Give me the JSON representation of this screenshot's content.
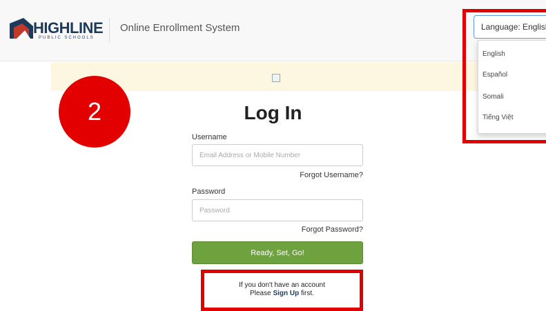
{
  "header": {
    "logo_text": "HIGHLINE",
    "logo_subtext": "PUBLIC SCHOOLS",
    "app_title": "Online Enrollment System"
  },
  "language": {
    "button_label": "Language:  English",
    "options": [
      "English",
      "Español",
      "Somali",
      "Tiếng Việt"
    ]
  },
  "step": {
    "number": "2"
  },
  "login": {
    "title": "Log In",
    "username_label": "Username",
    "username_placeholder": "Email Address or Mobile Number",
    "forgot_username": "Forgot Username?",
    "password_label": "Password",
    "password_placeholder": "Password",
    "forgot_password": "Forgot Password?",
    "submit_label": "Ready, Set, Go!"
  },
  "signup": {
    "line1": "If you don't have an account",
    "line2_prefix": "Please ",
    "line2_link": "Sign Up",
    "line2_suffix": " first."
  },
  "colors": {
    "brand_navy": "#1b3a5c",
    "submit_green": "#6ea23e",
    "highlight_red": "#e00000",
    "banner_yellow": "#fdf7e1"
  }
}
